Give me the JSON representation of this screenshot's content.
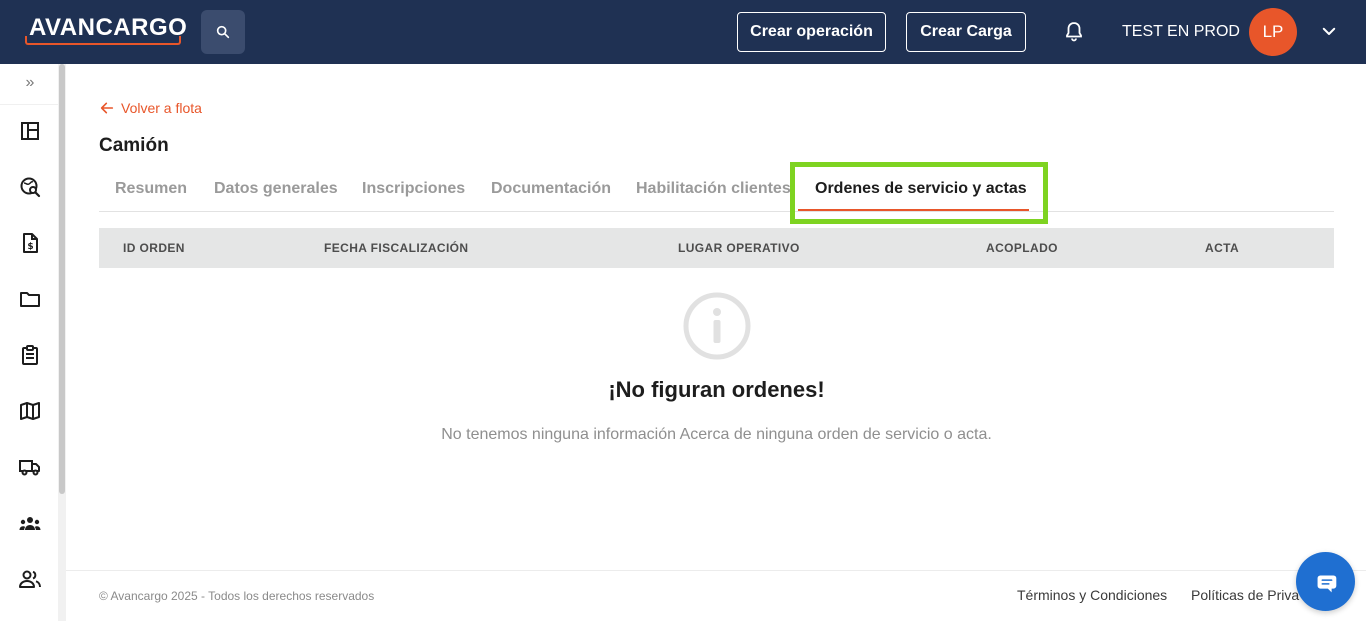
{
  "header": {
    "logo_text": "AVANCARGO",
    "search_icon": "search-icon",
    "create_operation_label": "Crear operación",
    "create_load_label": "Crear Carga",
    "bell_icon": "bell-icon",
    "user_name": "TEST EN PROD",
    "avatar_initials": "LP",
    "chevron_icon": "chevron-down-icon",
    "brand_color": "#1f3153",
    "accent_color": "#e8562a"
  },
  "sidebar": {
    "expand_icon": "»",
    "items": [
      {
        "name": "dashboard-icon"
      },
      {
        "name": "tracking-search-icon"
      },
      {
        "name": "invoice-icon"
      },
      {
        "name": "folder-icon"
      },
      {
        "name": "clipboard-icon"
      },
      {
        "name": "map-icon"
      },
      {
        "name": "truck-icon"
      },
      {
        "name": "group-icon"
      },
      {
        "name": "users-icon"
      }
    ]
  },
  "page": {
    "back_label": "Volver a flota",
    "title": "Camión",
    "tabs": [
      {
        "label": "Resumen"
      },
      {
        "label": "Datos generales"
      },
      {
        "label": "Inscripciones"
      },
      {
        "label": "Documentación"
      },
      {
        "label": "Habilitación clientes"
      },
      {
        "label": "Ordenes de servicio y actas",
        "active": true
      }
    ],
    "highlight_color": "#7ed321"
  },
  "table": {
    "columns": [
      "ID ORDEN",
      "FECHA FISCALIZACIÓN",
      "LUGAR OPERATIVO",
      "ACOPLADO",
      "ACTA"
    ],
    "rows": []
  },
  "empty_state": {
    "icon": "info-icon",
    "title": "¡No figuran ordenes!",
    "description": "No tenemos ninguna información Acerca de ninguna orden de servicio o acta."
  },
  "footer": {
    "copyright": "© Avancargo 2025 - Todos los derechos reservados",
    "terms_label": "Términos y Condiciones",
    "privacy_label": "Políticas de Priva"
  },
  "chat": {
    "icon": "chat-icon"
  }
}
